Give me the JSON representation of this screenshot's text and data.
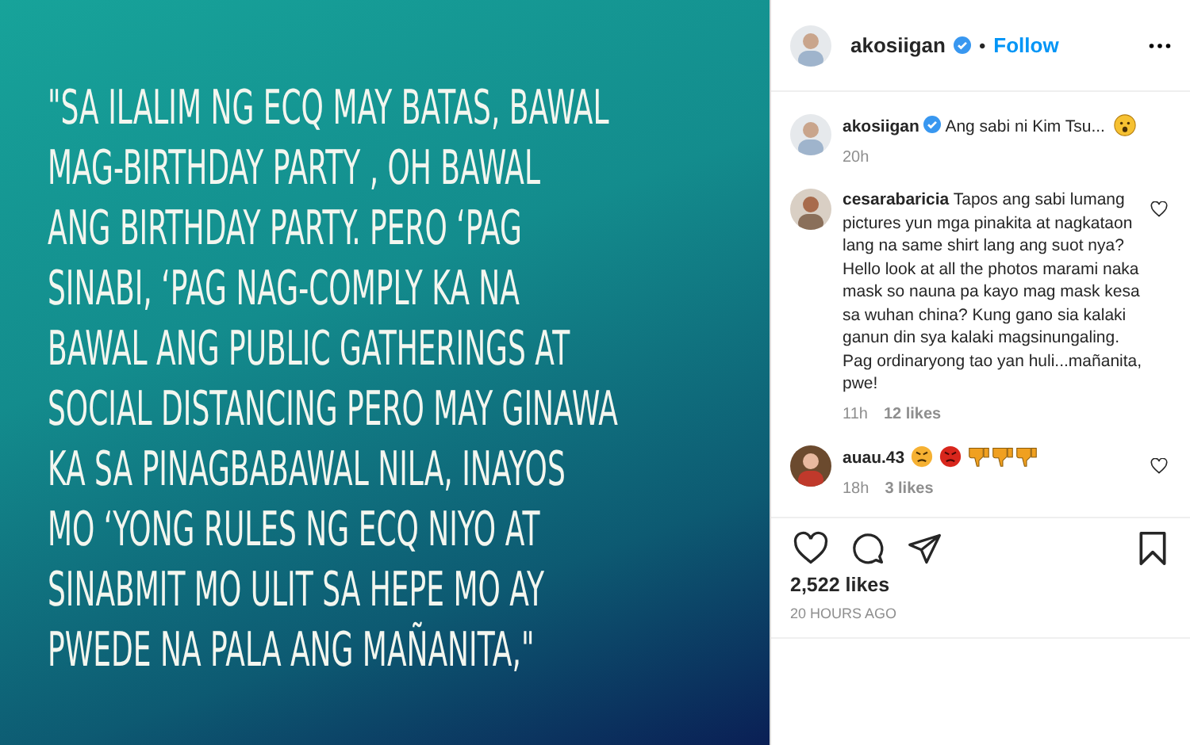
{
  "post_image": {
    "lines": [
      "\"SA ILALIM NG ECQ MAY BATAS, BAWAL",
      "MAG-BIRTHDAY PARTY , OH BAWAL",
      "ANG BIRTHDAY PARTY. PERO ‘PAG",
      "SINABI, ‘PAG NAG-COMPLY KA NA",
      "BAWAL ANG PUBLIC GATHERINGS AT",
      "SOCIAL DISTANCING PERO MAY GINAWA",
      "KA SA PINAGBABAWAL NILA, INAYOS",
      "MO ‘YONG RULES NG ECQ  NIYO AT",
      "SINABMIT MO ULIT SA HEPE MO AY",
      "PWEDE NA PALA ANG MAÑANITA,\""
    ]
  },
  "header": {
    "username": "akosiigan",
    "verified": true,
    "separator": "•",
    "follow": "Follow"
  },
  "comments": [
    {
      "username": "akosiigan",
      "verified": true,
      "text": "Ang sabi ni Kim Tsu...",
      "time": "20h",
      "kind": "caption"
    },
    {
      "username": "cesarabaricia",
      "verified": false,
      "text": "Tapos ang sabi lumang pictures yun mga pinakita at nagkataon lang na same shirt lang ang suot nya? Hello look at all the photos marami naka mask so nauna pa kayo mag mask kesa sa wuhan china? Kung gano sia kalaki ganun din sya kalaki magsinungaling. Pag ordinaryong tao yan huli...mañanita, pwe!",
      "time": "11h",
      "likes": "12 likes",
      "kind": "comment"
    },
    {
      "username": "auau.43",
      "verified": false,
      "time": "18h",
      "likes": "3 likes",
      "kind": "reactions"
    }
  ],
  "likes": "2,522 likes",
  "posted": "20 HOURS AGO"
}
